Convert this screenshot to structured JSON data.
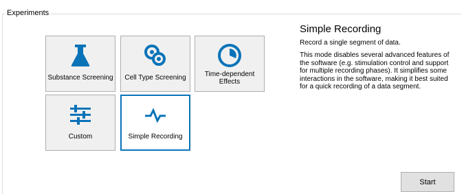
{
  "group": {
    "label": "Experiments"
  },
  "tiles": [
    {
      "label": "Substance Screening",
      "icon": "flask-icon"
    },
    {
      "label": "Cell Type Screening",
      "icon": "cells-icon"
    },
    {
      "label": "Time-dependent Effects",
      "icon": "pie-clock-icon"
    },
    {
      "label": "Custom",
      "icon": "sliders-icon"
    },
    {
      "label": "Simple Recording",
      "icon": "pulse-icon",
      "selected": true
    }
  ],
  "detail": {
    "title": "Simple Recording",
    "subtitle": "Record a single segment of data.",
    "description": "This mode disables several advanced features of the software (e.g. stimulation control and support for multiple recording phases). It simplifies some interactions in the software, making it best suited for a quick recording of a data segment."
  },
  "actions": {
    "start_label": "Start"
  },
  "colors": {
    "accent": "#0a73b8",
    "tile_bg": "#f0f0f0",
    "border": "#adadad"
  }
}
